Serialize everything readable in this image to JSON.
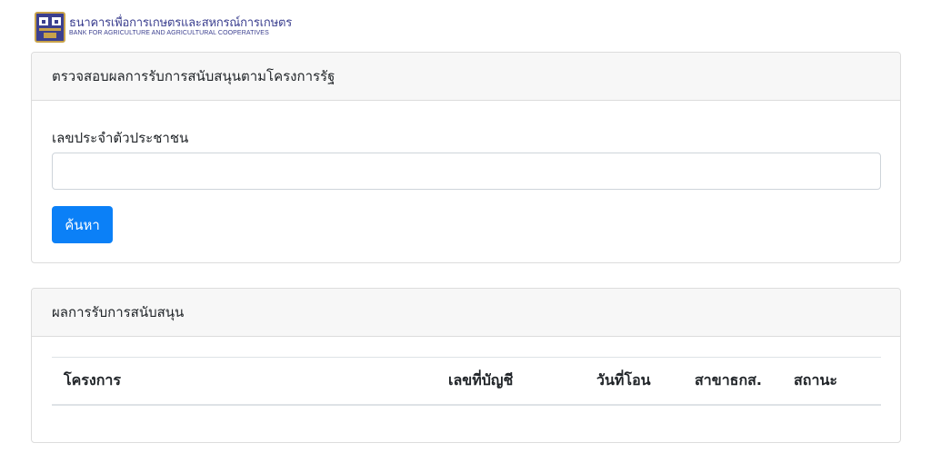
{
  "header": {
    "logo_icon": "baac-logo-icon",
    "logo_thai": "ธนาคารเพื่อการเกษตรและสหกรณ์การเกษตร",
    "logo_english": "BANK FOR AGRICULTURE AND AGRICULTURAL COOPERATIVES"
  },
  "search_card": {
    "title": "ตรวจสอบผลการรับการสนับสนุนตามโครงการรัฐ",
    "id_label": "เลขประจำตัวประชาชน",
    "id_value": "",
    "search_button": "ค้นหา"
  },
  "result_card": {
    "title": "ผลการรับการสนับสนุน",
    "columns": [
      "โครงการ",
      "เลขที่บัญชี",
      "วันที่โอน",
      "สาขาธกส.",
      "สถานะ"
    ],
    "rows": []
  },
  "colors": {
    "primary_button": "#0b80f7",
    "logo_blue": "#3b3f8f",
    "logo_gold": "#c8a24a",
    "card_header_bg": "#f7f7f7"
  }
}
